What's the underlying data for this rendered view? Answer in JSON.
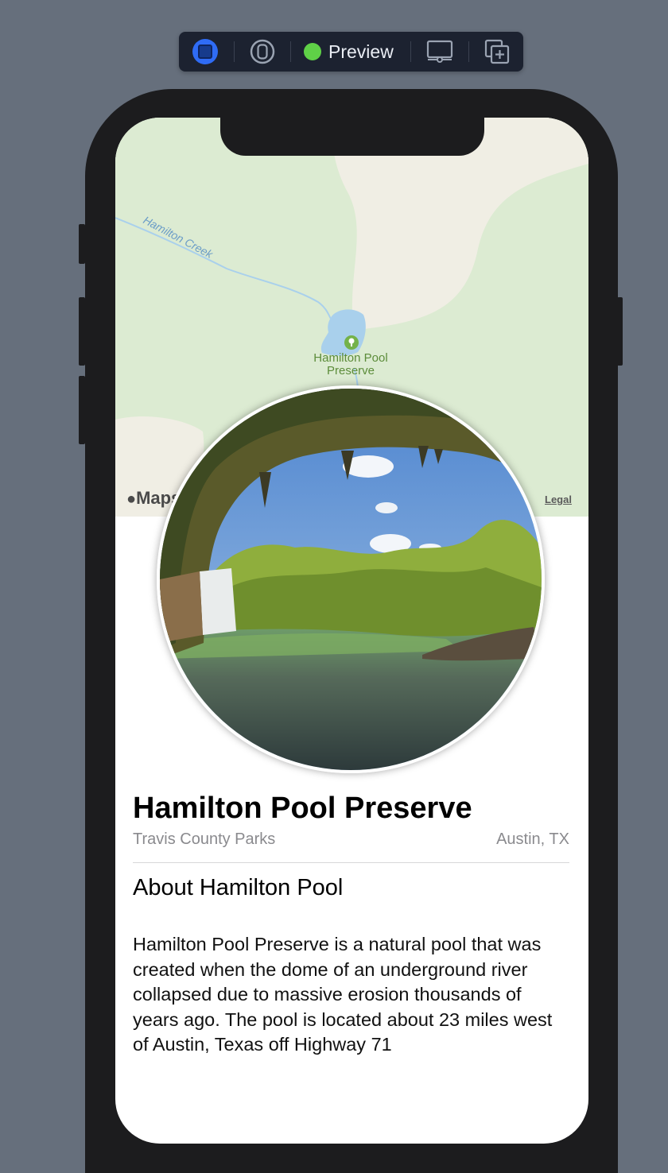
{
  "toolbar": {
    "preview_label": "Preview",
    "icons": [
      "live-preview-icon",
      "selectable-icon",
      "device-settings-icon",
      "duplicate-icon"
    ],
    "preview_status_color": "#5fd147",
    "live_color": "#2f6cf5"
  },
  "map": {
    "creek_label": "Hamilton Creek",
    "poi_label_line1": "Hamilton Pool",
    "poi_label_line2": "Preserve",
    "maps_brand": "Maps",
    "legal_link": "Legal"
  },
  "detail": {
    "title": "Hamilton Pool Preserve",
    "park": "Travis County Parks",
    "state": "Austin, TX",
    "about_heading": "About Hamilton Pool",
    "description": "Hamilton Pool Preserve is a natural pool that was created when the dome of an underground river collapsed due to massive erosion thousands of years ago. The pool is located about 23 miles west of Austin, Texas off Highway 71"
  }
}
